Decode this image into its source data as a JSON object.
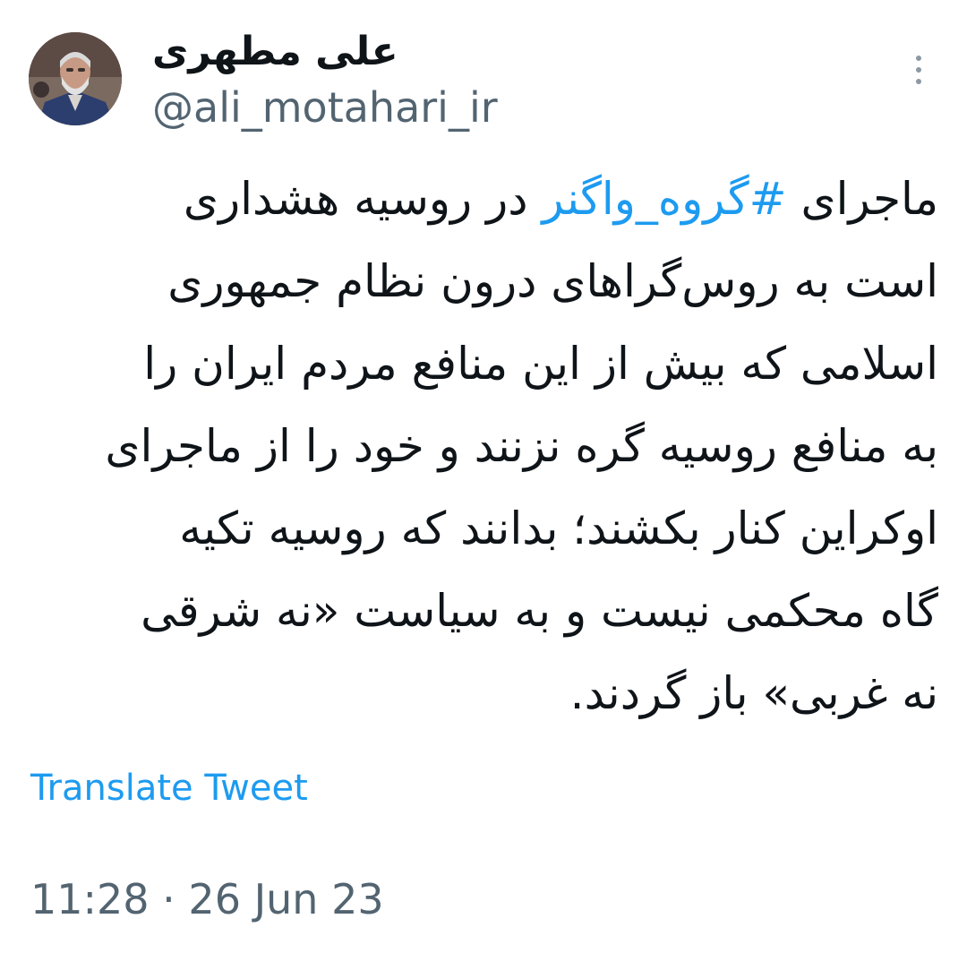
{
  "tweet": {
    "author": {
      "display_name": "علی مطهری",
      "handle": "@ali_motahari_ir",
      "avatar_icon": "profile-photo"
    },
    "more_icon": "vertical-ellipsis-icon",
    "lines": [
      {
        "before": "ماجرای ",
        "hashtag": "#گروه_واگنر",
        "after": " در روسیه هشداری"
      },
      {
        "before": "است به روس‌گراهای درون نظام جمهوری",
        "hashtag": "",
        "after": ""
      },
      {
        "before": "اسلامی که بیش از این منافع مردم ایران را",
        "hashtag": "",
        "after": ""
      },
      {
        "before": "به منافع روسیه گره نزنند و خود را از ماجرای",
        "hashtag": "",
        "after": ""
      },
      {
        "before": "اوکراین کنار بکشند؛ بدانند که روسیه تکیه",
        "hashtag": "",
        "after": ""
      },
      {
        "before": "گاه محکمی نیست و به سیاست «نه شرقی",
        "hashtag": "",
        "after": ""
      },
      {
        "before": "نه غربی» باز گردند.",
        "hashtag": "",
        "after": ""
      }
    ],
    "translate_label": "Translate Tweet",
    "timestamp": "11:28 · 26 Jun 23"
  },
  "colors": {
    "link": "#1d9bf0",
    "secondary_text": "#536471",
    "primary_text": "#0f1419"
  }
}
